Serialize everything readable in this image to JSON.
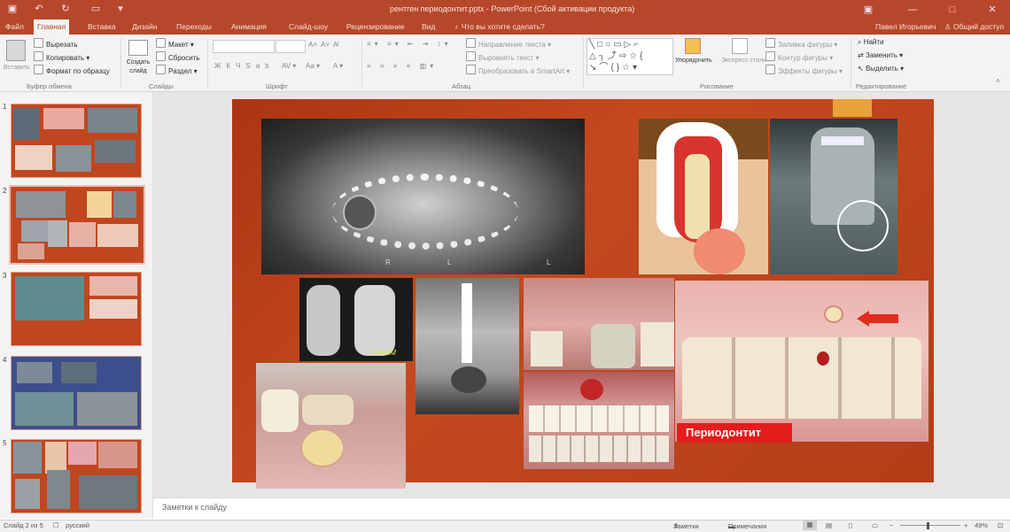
{
  "app": {
    "document_title": "рентген периодонтит.pptx - PowerPoint (Сбой активации продукта)"
  },
  "tabs": [
    {
      "label": "Файл"
    },
    {
      "label": "Главная"
    },
    {
      "label": "Вставка"
    },
    {
      "label": "Дизайн"
    },
    {
      "label": "Переходы"
    },
    {
      "label": "Анимация"
    },
    {
      "label": "Слайд-шоу"
    },
    {
      "label": "Рецензирование"
    },
    {
      "label": "Вид"
    },
    {
      "label": "Что вы хотите сделать?"
    }
  ],
  "account": {
    "user": "Павел Игорьевич",
    "share": "Общий доступ"
  },
  "ribbon": {
    "clipboard": {
      "paste": "Вставить",
      "cut": "Вырезать",
      "copy": "Копировать",
      "format_painter": "Формат по образцу",
      "label": "Буфер обмена"
    },
    "slides": {
      "new_slide": "Создать слайд",
      "layout": "Макет",
      "reset": "Сбросить",
      "section": "Раздел",
      "label": "Слайды"
    },
    "font": {
      "label": "Шрифт"
    },
    "paragraph": {
      "text_direction": "Направление текста",
      "align_text": "Выровнять текст",
      "smartart": "Преобразовать в SmartArt",
      "label": "Абзац"
    },
    "drawing": {
      "arrange": "Упорядочить",
      "quick_styles": "Экспресс-стили",
      "shape_fill": "Заливка фигуры",
      "shape_outline": "Контур фигуры",
      "shape_effects": "Эффекты фигуры",
      "label": "Рисование"
    },
    "editing": {
      "find": "Найти",
      "replace": "Заменить",
      "select": "Выделить",
      "label": "Редактирование"
    }
  },
  "thumbnails": [
    {
      "number": "1"
    },
    {
      "number": "2"
    },
    {
      "number": "3"
    },
    {
      "number": "4"
    },
    {
      "number": "5"
    }
  ],
  "slide": {
    "caption": "Периодонтит",
    "xray_letters": [
      "R",
      "L",
      "L"
    ],
    "signature": "L.dentM"
  },
  "notes_placeholder": "Заметки к слайду",
  "status": {
    "slide_info": "Слайд 2 из 5",
    "language": "русский",
    "notes": "Заметки",
    "comments": "Примечания",
    "zoom": "49%"
  },
  "colors": {
    "accent": "#b7472a",
    "slide_bg": "#c0461f"
  }
}
